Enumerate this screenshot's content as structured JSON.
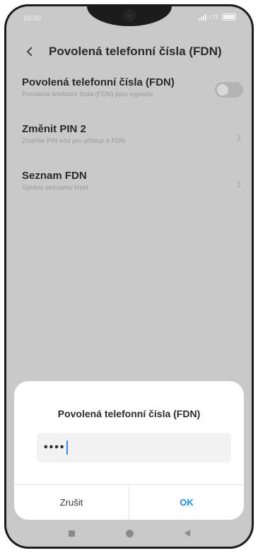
{
  "statusbar": {
    "time": "10:00",
    "network": "LTE"
  },
  "header": {
    "title": "Povolená telefonní čísla (FDN)"
  },
  "list": {
    "items": [
      {
        "title": "Povolená telefonní čísla (FDN)",
        "subtitle": "Povolená telefonní čísla (FDN) jsou vypnuta"
      },
      {
        "title": "Změnit PIN 2",
        "subtitle": "Změňte PIN kód pro přístup k FDN"
      },
      {
        "title": "Seznam FDN",
        "subtitle": "Správa seznamu čísel"
      }
    ]
  },
  "dialog": {
    "title": "Povolená telefonní čísla (FDN)",
    "input_value": "••••",
    "cancel_label": "Zrušit",
    "ok_label": "OK"
  },
  "colors": {
    "accent": "#1d8cf0",
    "overlay": "#c9c9c9"
  },
  "icons": {
    "back": "back-arrow-icon",
    "chevron": "chevron-right-icon"
  }
}
